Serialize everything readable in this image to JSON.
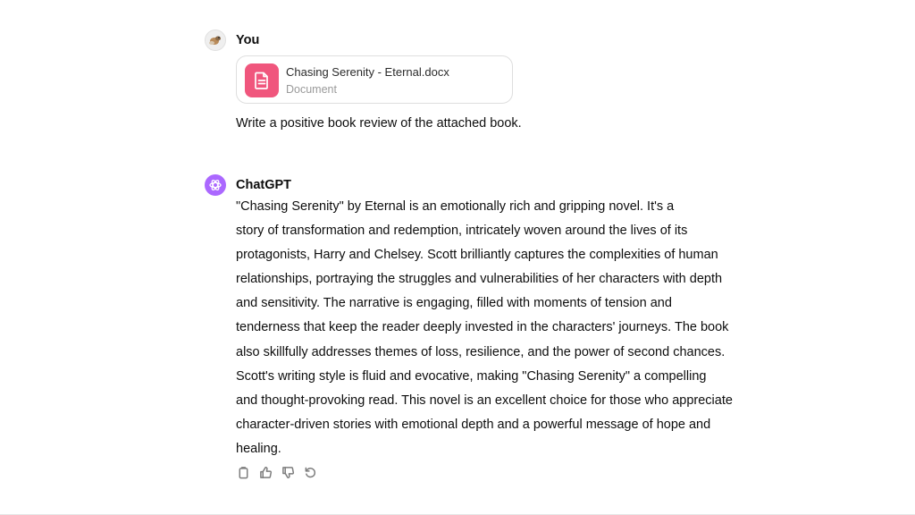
{
  "conversation": {
    "user": {
      "author": "You",
      "attachment": {
        "file_name": "Chasing Serenity - Eternal.docx",
        "file_type": "Document",
        "icon": "document-icon",
        "accent": "#f0567d"
      },
      "prompt": "Write a positive book review of the attached book."
    },
    "assistant": {
      "author": "ChatGPT",
      "accent": "#ab68ff",
      "lines": [
        "\"Chasing Serenity\" by Eternal is an emotionally rich and gripping novel. It's a",
        "story of transformation and redemption, intricately woven around the lives of its",
        "protagonists, Harry and Chelsey. Scott brilliantly captures the complexities of human",
        "relationships, portraying the struggles and vulnerabilities of her characters with depth",
        "and sensitivity. The narrative is engaging, filled with moments of tension and",
        "tenderness that keep the reader deeply invested in the characters' journeys. The book",
        "also skillfully addresses themes of loss, resilience, and the power of second chances.",
        "Scott's writing style is fluid and evocative, making \"Chasing Serenity\" a compelling",
        "and thought-provoking read. This novel is an excellent choice for those who appreciate",
        "character-driven stories with emotional depth and a powerful message of hope and",
        "healing."
      ],
      "actions": [
        "copy-icon",
        "thumbs-up-icon",
        "thumbs-down-icon",
        "regenerate-icon"
      ]
    }
  }
}
